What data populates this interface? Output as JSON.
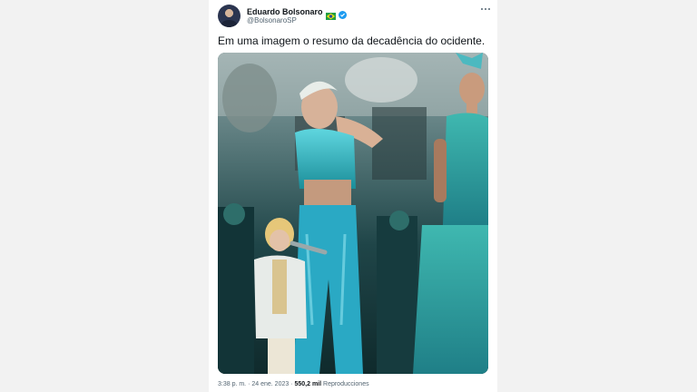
{
  "tweet": {
    "author": {
      "display_name": "Eduardo Bolsonaro",
      "handle": "@BolsonaroSP",
      "flag_icon": "brazil-flag-icon",
      "verified_icon": "verified-badge-icon"
    },
    "more_icon": "more-options-icon",
    "text": "Em uma imagem o resumo da decadência do ocidente.",
    "footer": {
      "time": "3:38 p. m.",
      "separator": " · ",
      "date": "24 ene. 2023",
      "views_count": "550,2 mil",
      "views_label": " Reproducciones"
    },
    "colors": {
      "accent": "#1d9bf0",
      "text": "#0f1419",
      "muted": "#536471"
    }
  }
}
